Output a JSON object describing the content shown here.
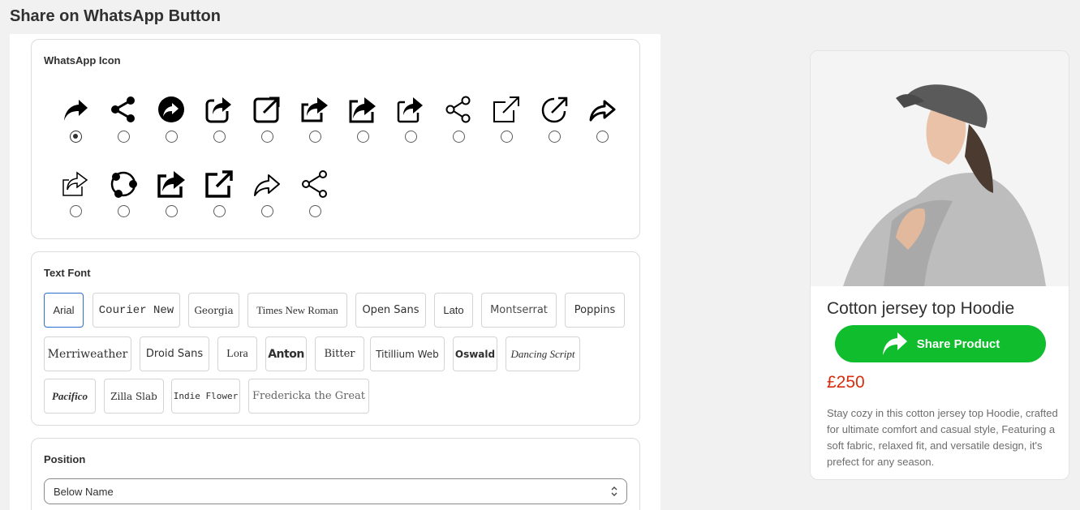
{
  "page": {
    "title": "Share on WhatsApp Button"
  },
  "icon_section": {
    "title": "WhatsApp Icon",
    "icons": [
      {
        "name": "curved-arrow-share-icon",
        "selected": true
      },
      {
        "name": "share-nodes-icon",
        "selected": false
      },
      {
        "name": "share-circle-icon",
        "selected": false
      },
      {
        "name": "share-box-rounded-icon",
        "selected": false
      },
      {
        "name": "external-link-icon",
        "selected": false
      },
      {
        "name": "share-box-arrow-icon",
        "selected": false
      },
      {
        "name": "share-box-filled-icon",
        "selected": false
      },
      {
        "name": "share-box-outline-icon",
        "selected": false
      },
      {
        "name": "share-nodes-outline-icon",
        "selected": false
      },
      {
        "name": "external-link-thin-icon",
        "selected": false
      },
      {
        "name": "external-link-circle-icon",
        "selected": false
      },
      {
        "name": "forward-arrow-icon",
        "selected": false
      },
      {
        "name": "share-box-thin-icon",
        "selected": false
      },
      {
        "name": "share-circles-icon",
        "selected": false
      },
      {
        "name": "share-box-bold-icon",
        "selected": false
      },
      {
        "name": "external-link-bold-icon",
        "selected": false
      },
      {
        "name": "forward-arrow-outline-icon",
        "selected": false
      },
      {
        "name": "share-nodes-thin-icon",
        "selected": false
      }
    ]
  },
  "font_section": {
    "title": "Text Font",
    "fonts": [
      {
        "label": "Arial",
        "selected": true
      },
      {
        "label": "Courier New",
        "selected": false
      },
      {
        "label": "Georgia",
        "selected": false
      },
      {
        "label": "Times New Roman",
        "selected": false
      },
      {
        "label": "Open Sans",
        "selected": false
      },
      {
        "label": "Lato",
        "selected": false
      },
      {
        "label": "Montserrat",
        "selected": false
      },
      {
        "label": "Poppins",
        "selected": false
      },
      {
        "label": "Merriweather",
        "selected": false
      },
      {
        "label": "Droid Sans",
        "selected": false
      },
      {
        "label": "Lora",
        "selected": false
      },
      {
        "label": "Anton",
        "selected": false
      },
      {
        "label": "Bitter",
        "selected": false
      },
      {
        "label": "Titillium Web",
        "selected": false
      },
      {
        "label": "Oswald",
        "selected": false
      },
      {
        "label": "Dancing Script",
        "selected": false
      },
      {
        "label": "Pacifico",
        "selected": false
      },
      {
        "label": "Zilla Slab",
        "selected": false
      },
      {
        "label": "Indie Flower",
        "selected": false
      },
      {
        "label": "Fredericka the Great",
        "selected": false
      }
    ]
  },
  "position_section": {
    "title": "Position",
    "value": "Below Name"
  },
  "preview": {
    "product_name": "Cotton jersey top Hoodie",
    "button_label": "Share Product",
    "button_color": "#0fbd2d",
    "price": "£250",
    "price_color": "#d72c0d",
    "description": "Stay cozy in this cotton jersey top Hoodie, crafted for ultimate comfort and casual style, Featuring a soft fabric, relaxed fit, and versatile design, it's prefect for any season."
  }
}
